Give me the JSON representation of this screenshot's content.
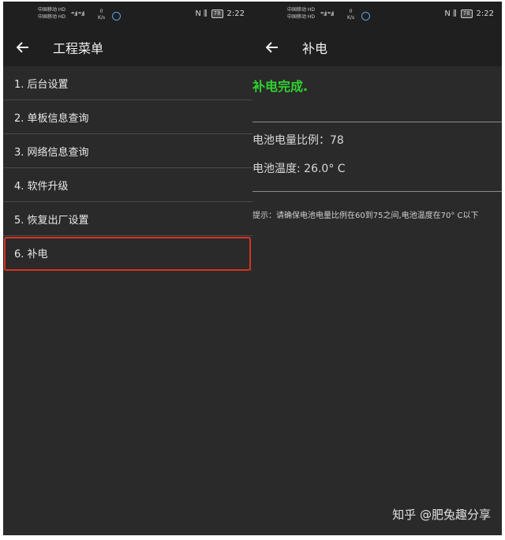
{
  "status_bar": {
    "carrier_line1": "中国移动 HD",
    "carrier_line2": "中国移动 HD",
    "signal": "⁴⁶.ıll ⁴⁶.ıll",
    "net_speed": "0",
    "net_speed_unit": "K/s",
    "battery": "78",
    "time": "2:22",
    "nfc_vibrate": "N ⫼"
  },
  "left_screen": {
    "title": "工程菜单",
    "menu": [
      {
        "label": "1. 后台设置"
      },
      {
        "label": "2. 单板信息查询"
      },
      {
        "label": "3. 网络信息查询"
      },
      {
        "label": "4. 软件升级"
      },
      {
        "label": "5. 恢复出厂设置"
      },
      {
        "label": "6. 补电",
        "selected": true
      }
    ]
  },
  "right_screen": {
    "title": "补电",
    "status": "补电完成.",
    "battery_ratio": "电池电量比例：78",
    "battery_temp": "电池温度: 26.0° C",
    "hint": "提示：请确保电池电量比例在60到75之间,电池温度在70° C以下"
  },
  "watermark": "知乎 @肥兔趣分享",
  "colors": {
    "background": "#2a2a2a",
    "bar": "#1f1f1f",
    "success": "#2fd22f",
    "highlight_border": "#d6331f"
  }
}
